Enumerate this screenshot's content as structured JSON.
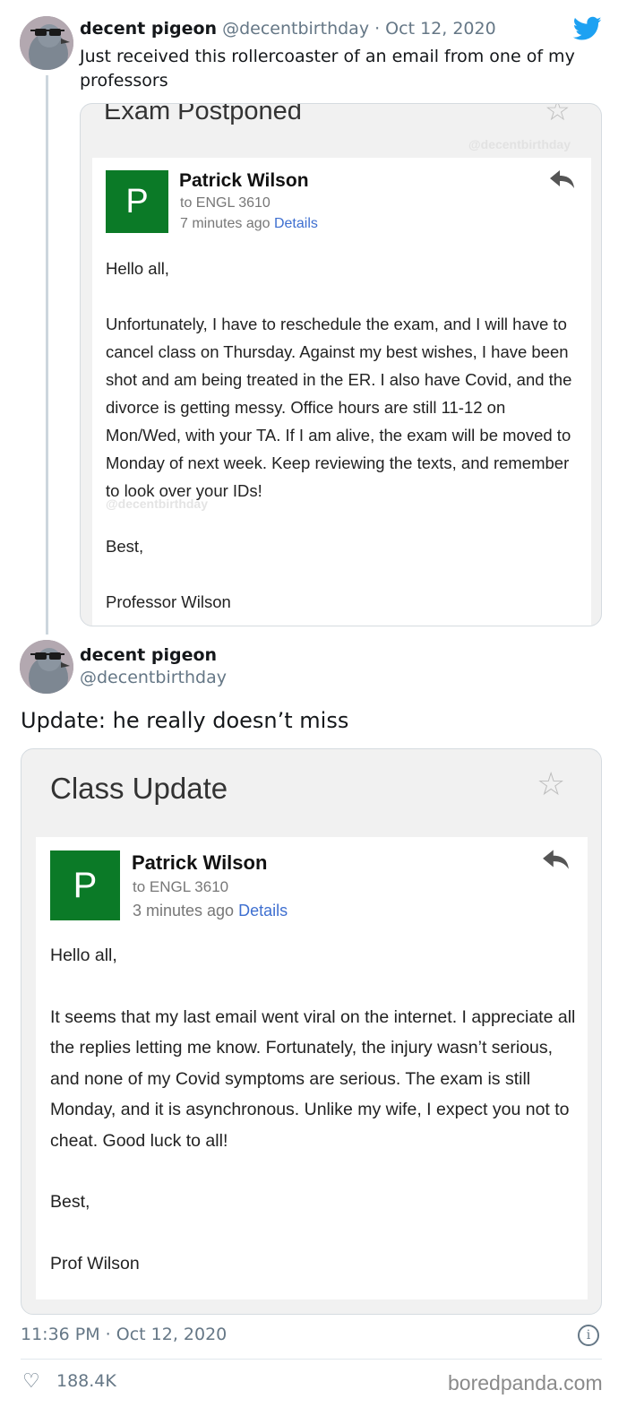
{
  "tweet1": {
    "display_name": "decent pigeon",
    "handle_date": "@decentbirthday · Oct 12, 2020",
    "text": "Just received this rollercoaster of an email from one of my professors"
  },
  "email1": {
    "subject": "Exam Postponed",
    "watermark": "@decentbirthday",
    "sender_initial": "P",
    "sender_name": "Patrick Wilson",
    "to": "to ENGL 3610",
    "time": "7 minutes ago",
    "details_link": "Details",
    "greeting": "Hello all,",
    "paragraph": "Unfortunately, I have to reschedule the exam, and I will have to cancel class on Thursday. Against my best wishes, I have been shot and am being treated in the ER. I also have Covid, and the divorce is getting messy. Office hours are still 11-12 on Mon/Wed, with your TA. If I am alive, the exam will be moved to Monday of next week. Keep reviewing the texts, and remember to look over your IDs!",
    "watermark_body": "@decentbirthday",
    "closing": "Best,",
    "signature": "Professor Wilson"
  },
  "tweet2": {
    "display_name": "decent pigeon",
    "handle": "@decentbirthday",
    "text": "Update: he really doesn’t miss"
  },
  "email2": {
    "subject": "Class Update",
    "sender_initial": "P",
    "sender_name": "Patrick Wilson",
    "to": "to ENGL 3610",
    "time": "3 minutes ago",
    "details_link": "Details",
    "greeting": "Hello all,",
    "paragraph": "It seems that my last email went viral on the internet. I appreciate all the replies letting me know. Fortunately, the injury wasn’t serious, and none of my Covid symptoms are serious. The exam is still Monday, and it is asynchronous. Unlike my wife, I expect you not to cheat. Good luck to all!",
    "closing": "Best,",
    "signature": "Prof Wilson"
  },
  "footer": {
    "timestamp": "11:36 PM · Oct 12, 2020",
    "likes": "188.4K",
    "site_logo": "boredpanda.com"
  },
  "icons": {
    "twitter": "twitter-bird-icon",
    "star": "star-icon",
    "reply": "reply-arrow-icon",
    "info": "info-icon",
    "like": "heart-icon"
  },
  "colors": {
    "twitter_blue": "#1da1f2",
    "sender_avatar": "#0b7a27",
    "link": "#3e6fd0",
    "muted": "#657786"
  }
}
